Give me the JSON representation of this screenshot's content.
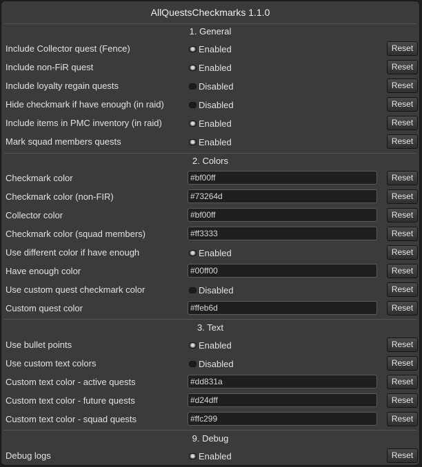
{
  "title": "AllQuestsCheckmarks 1.1.0",
  "sections": {
    "general": "1. General",
    "colors": "2. Colors",
    "text": "3. Text",
    "debug": "9. Debug"
  },
  "reset_label": "Reset",
  "rows": [
    {
      "label": "Include Collector quest (Fence)",
      "state": "Enabled"
    },
    {
      "label": "Include non-FiR quest",
      "state": "Enabled"
    },
    {
      "label": "Include loyalty regain quests",
      "state": "Disabled"
    },
    {
      "label": "Hide checkmark if have enough (in raid)",
      "state": "Disabled"
    },
    {
      "label": "Include items in PMC inventory (in raid)",
      "state": "Enabled"
    },
    {
      "label": "Mark squad members quests",
      "state": "Enabled"
    },
    {
      "label": "Checkmark color",
      "value": "#bf00ff"
    },
    {
      "label": "Checkmark color (non-FIR)",
      "value": "#73264d"
    },
    {
      "label": "Collector color",
      "value": "#bf00ff"
    },
    {
      "label": "Checkmark color (squad members)",
      "value": "#ff3333"
    },
    {
      "label": "Use different color if have enough",
      "state": "Enabled"
    },
    {
      "label": "Have enough color",
      "value": "#00ff00"
    },
    {
      "label": "Use custom quest checkmark color",
      "state": "Disabled"
    },
    {
      "label": "Custom quest color",
      "value": "#ffeb6d"
    },
    {
      "label": "Use bullet points",
      "state": "Enabled"
    },
    {
      "label": "Use custom text colors",
      "state": "Disabled"
    },
    {
      "label": "Custom text color - active quests",
      "value": "#dd831a"
    },
    {
      "label": "Custom text color - future quests",
      "value": "#d24dff"
    },
    {
      "label": "Custom text color - squad quests",
      "value": "#ffc299"
    },
    {
      "label": "Debug logs",
      "state": "Enabled"
    }
  ]
}
